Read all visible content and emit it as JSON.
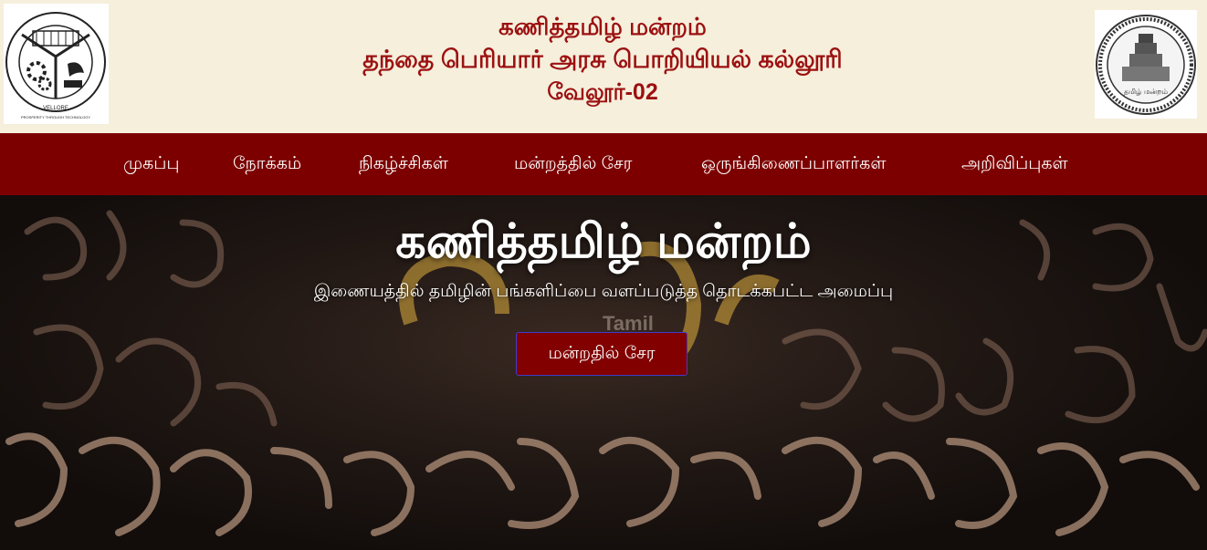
{
  "header": {
    "line1": "கணித்தமிழ் மன்றம்",
    "line2": "தந்தை பெரியார் அரசு பொறியியல் கல்லூரி",
    "line3": "வேலூர்-02",
    "left_logo": {
      "arc_text": "THANTHAI PERIYAR GOVERNMENT INSTITUTE OF TECHNOLOGY",
      "city": "VELLORE",
      "motto": "PROSPERITY THROUGH TECHNOLOGY"
    },
    "right_logo": {
      "caption": "தமிழ் மன்றம்"
    }
  },
  "nav": {
    "items": [
      {
        "label": "முகப்பு"
      },
      {
        "label": "நோக்கம்"
      },
      {
        "label": "நிகழ்ச்சிகள்"
      },
      {
        "label": "மன்றத்தில் சேர"
      },
      {
        "label": "ஒருங்கிணைப்பாளர்கள்"
      },
      {
        "label": "அறிவிப்புகள்"
      }
    ]
  },
  "hero": {
    "title": "கணித்தமிழ் மன்றம்",
    "subtitle": "இணையத்தில் தமிழின் பங்களிப்பை வளப்படுத்த தொடக்கபட்ட அமைப்பு",
    "join_button": "மன்றதில் சேர",
    "background_word": "Tamil"
  },
  "colors": {
    "header_bg": "#f5efdc",
    "header_text": "#9c1010",
    "nav_bg": "#7d0000",
    "button_bg": "#820000",
    "button_border": "#3d3dc8"
  }
}
